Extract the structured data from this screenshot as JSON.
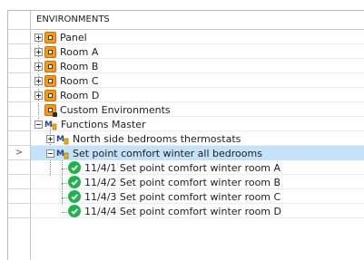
{
  "tree": {
    "header": "ENVIRONMENTS",
    "row_marker": ">",
    "items": [
      {
        "label": "Panel"
      },
      {
        "label": "Room A"
      },
      {
        "label": "Room B"
      },
      {
        "label": "Room C"
      },
      {
        "label": "Room D"
      },
      {
        "label": "Custom Environments"
      },
      {
        "label": "Functions Master"
      },
      {
        "label": "North side bedrooms thermostats"
      },
      {
        "label": "Set point comfort winter all bedrooms",
        "selected": true
      },
      {
        "label": "11/4/1 Set point comfort winter room A"
      },
      {
        "label": "11/4/2 Set point comfort winter room B"
      },
      {
        "label": "11/4/3 Set point comfort winter room C"
      },
      {
        "label": "11/4/4 Set point comfort winter room D"
      }
    ]
  },
  "colors": {
    "selection": "#c4e3f8",
    "environment_icon": "#f39a1e",
    "check_icon": "#23b14d"
  }
}
